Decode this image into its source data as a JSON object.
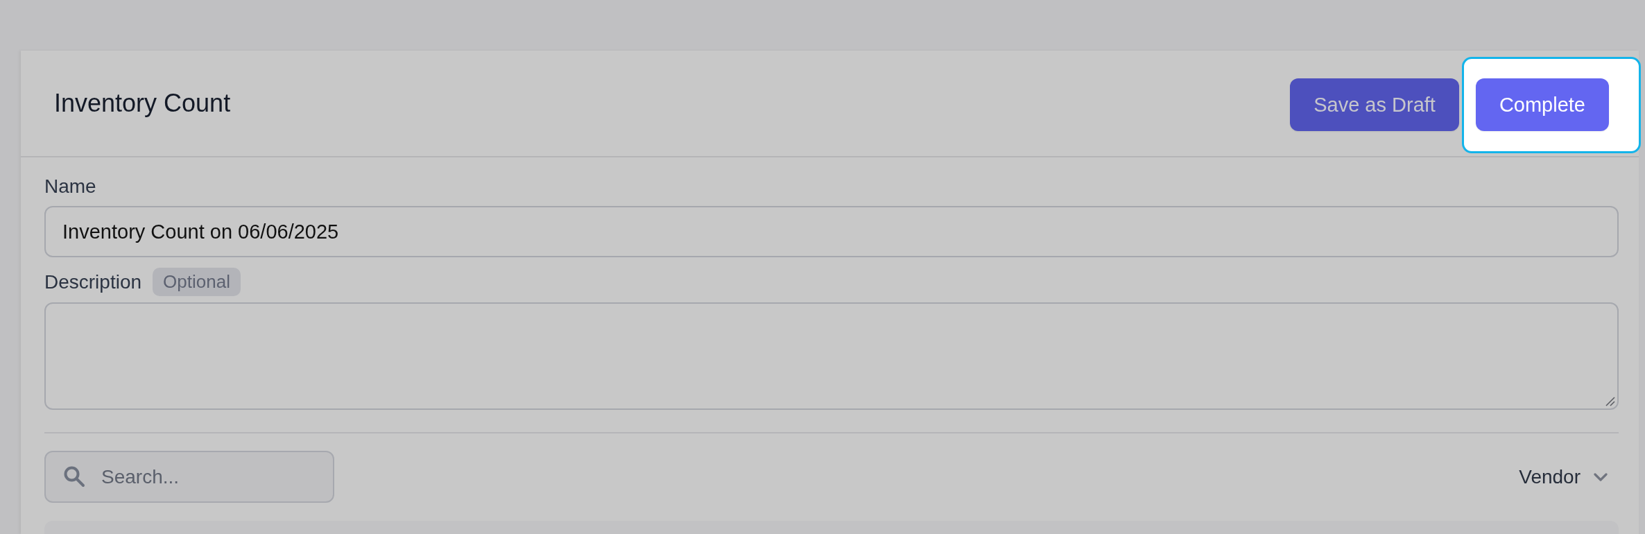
{
  "header": {
    "title": "Inventory Count",
    "buttons": [
      {
        "label": "Save as Draft",
        "highlighted": false
      },
      {
        "label": "Complete",
        "highlighted": true
      }
    ]
  },
  "form": {
    "name_field": {
      "label": "Name",
      "value": "Inventory Count on 06/06/2025"
    },
    "description_field": {
      "label": "Description",
      "badge": "Optional"
    }
  },
  "toolbar": {
    "search": {
      "placeholder": "Search..."
    },
    "filter": {
      "label": "Vendor"
    }
  }
}
